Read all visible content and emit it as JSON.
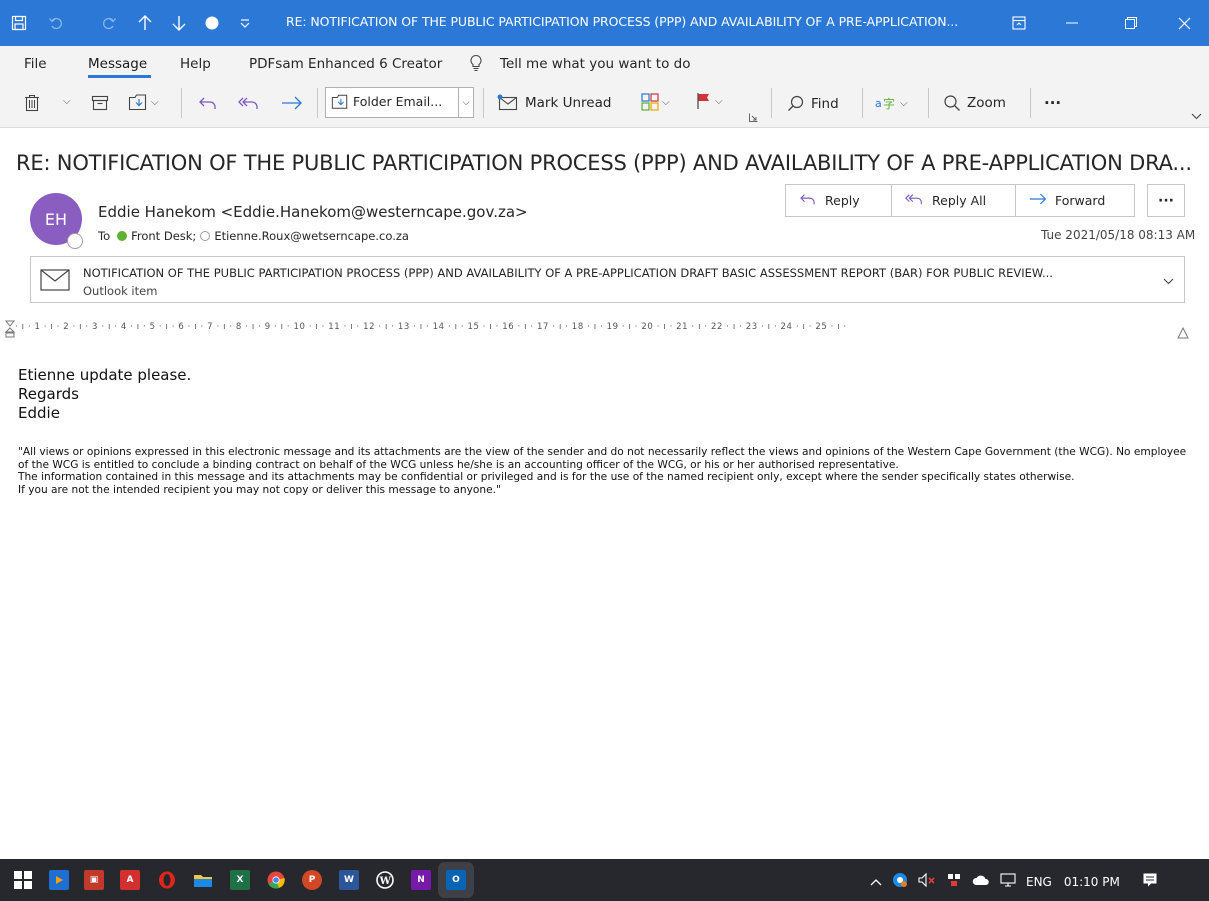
{
  "window": {
    "title": "RE: NOTIFICATION OF THE PUBLIC PARTICIPATION PROCESS (PPP) AND AVAILABILITY OF A PRE-APPLICATION..."
  },
  "menu": {
    "items": [
      "File",
      "Message",
      "Help",
      "PDFsam Enhanced 6 Creator"
    ],
    "active": "Message",
    "tell_me": "Tell me what you want to do"
  },
  "ribbon": {
    "folder_email": "Folder Email...",
    "mark_unread": "Mark Unread",
    "find": "Find",
    "zoom": "Zoom",
    "more": "···"
  },
  "message": {
    "subject": "RE: NOTIFICATION OF THE PUBLIC PARTICIPATION PROCESS (PPP) AND AVAILABILITY OF A PRE-APPLICATION DRA...",
    "avatar_initials": "EH",
    "sender": "Eddie Hanekom <Eddie.Hanekom@westerncape.gov.za>",
    "to_label": "To",
    "recipients": [
      "Front Desk;",
      "Etienne.Roux@wetserncape.co.za"
    ],
    "date": "Tue 2021/05/18 08:13 AM",
    "actions": {
      "reply": "Reply",
      "reply_all": "Reply All",
      "forward": "Forward",
      "more": "···"
    },
    "attachment": {
      "title": "NOTIFICATION OF THE PUBLIC PARTICIPATION PROCESS (PPP) AND AVAILABILITY OF A PRE-APPLICATION DRAFT BASIC ASSESSMENT REPORT (BAR) FOR PUBLIC REVIEW...",
      "subtitle": "Outlook item"
    }
  },
  "ruler": {
    "text": "· ı · 1 · ı · 2 · ı · 3 · ı · 4 · ı · 5 · ı · 6 · ı · 7 · ı · 8 · ı · 9 · ı · 10 · ı · 11 · ı · 12 · ı · 13 · ı · 14 · ı · 15 · ı · 16 · ı · 17 · ı · 18 · ı · 19 · ı · 20 · ı · 21 · ı · 22 · ı · 23 · ı · 24 · ı · 25 · ı ·"
  },
  "body": {
    "lines": [
      "Etienne update please.",
      "Regards",
      "Eddie"
    ],
    "disclaimer": [
      "\"All views or opinions expressed in this electronic message and its attachments are the view of the sender and do not necessarily reflect the views and opinions of the Western Cape Government (the WCG). No employee of the WCG is entitled to conclude a binding contract on behalf of the WCG unless he/she is an accounting officer of the WCG, or his or her authorised representative.",
      "The information contained in this message and its attachments may be confidential or privileged and is for the use of the named recipient only, except where the sender specifically states otherwise.",
      "If you are not the intended recipient you may not copy or deliver this message to anyone.\""
    ]
  },
  "taskbar": {
    "language": "ENG",
    "time": "01:10 PM"
  },
  "colors": {
    "titlebar": "#2b78d6",
    "avatar": "#8a5dc0",
    "flag": "#d13438",
    "taskbar": "#27282e"
  }
}
